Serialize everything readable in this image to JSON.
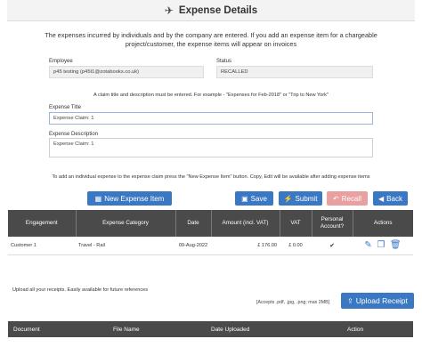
{
  "header": {
    "title": "Expense Details",
    "icon": "airplane-icon"
  },
  "intro": "The expenses incurred by individuals and by the company are entered. If you add an expense item for a chargeable project/customer, the expense items will appear on invoices",
  "employee": {
    "label": "Employee",
    "value": "p45 testing (p45t1@zotabooks.co.uk)"
  },
  "status": {
    "label": "Status",
    "value": "RECALLED"
  },
  "claim_hint": "A claim title and description must be entered. For example - \"Expenses for Feb-2018\" or \"Trip to New York\"",
  "expense_title": {
    "label": "Expense Title",
    "value": "Expense Claim: 1"
  },
  "expense_description": {
    "label": "Expense Description",
    "value": "Expense Claim: 1"
  },
  "add_hint": "To add an individual expense to the expense claim press the \"New Expense Item\" button. Copy, Edit will be available after adding expense items",
  "buttons": {
    "new_item": "New Expense Item",
    "save": "Save",
    "submit": "Submit",
    "recall": "Recall",
    "back": "Back",
    "upload": "Upload Receipt"
  },
  "colors": {
    "primary": "#3a78c4",
    "recall": "#e9a0a0",
    "header_bg": "#4a4a4a"
  },
  "expense_table": {
    "headers": [
      "Engagement",
      "Expense Category",
      "Date",
      "Amount (incl. VAT)",
      "VAT",
      "Personal Account?",
      "Actions"
    ],
    "rows": [
      {
        "engagement": "Customer 1",
        "category": "Travel - Rail",
        "date": "09-Aug-2022",
        "amount": "£ 176.00",
        "vat": "£ 0.00",
        "personal": "✔"
      }
    ]
  },
  "receipts_hint": "Upload all your receipts. Easily available for future references",
  "accepts": "[Accepts .pdf, .jpg, .png; max 2MB]",
  "documents_table": {
    "headers": [
      "Document",
      "File Name",
      "Date Uploaded",
      "Action"
    ]
  }
}
